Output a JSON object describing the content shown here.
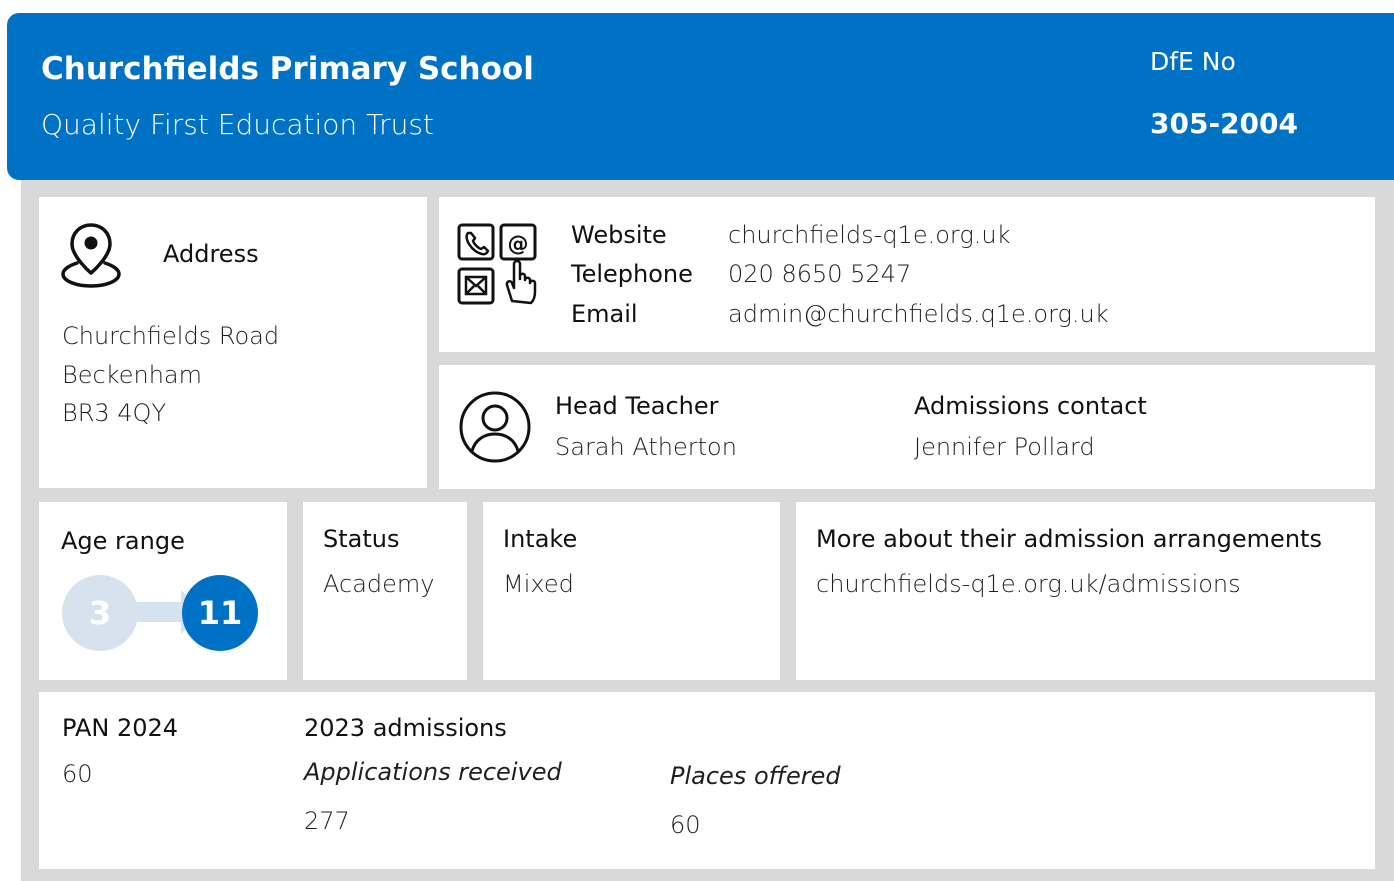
{
  "header": {
    "school_name": "Churchfields Primary School",
    "trust_name": "Quality First Education Trust",
    "dfe_label": "DfE No",
    "dfe_number": "305-2004",
    "color": "#0072c6"
  },
  "address": {
    "label": "Address",
    "lines": [
      "Churchfields Road",
      "Beckenham",
      "BR3 4QY"
    ],
    "icon": "location-pin-icon"
  },
  "contact": {
    "icon": "contact-methods-icon",
    "website_label": "Website",
    "website": "churchfields-q1e.org.uk",
    "telephone_label": "Telephone",
    "telephone": "020 8650 5247",
    "email_label": "Email",
    "email": "admin@churchfields.q1e.org.uk"
  },
  "people": {
    "icon": "person-icon",
    "head_label": "Head Teacher",
    "head_name": "Sarah Atherton",
    "admissions_label": "Admissions contact",
    "admissions_name": "Jennifer Pollard"
  },
  "age_range": {
    "label": "Age range",
    "from": "3",
    "to": "11",
    "from_color": "#d6e3ee",
    "to_color": "#0072c6"
  },
  "status": {
    "label": "Status",
    "value": "Academy"
  },
  "intake": {
    "label": "Intake",
    "value": "Mixed"
  },
  "more": {
    "label": "More about their admission arrangements",
    "link": "churchfields-q1e.org.uk/admissions"
  },
  "pan": {
    "label": "PAN 2024",
    "value": "60"
  },
  "admissions_2023": {
    "label": "2023 admissions",
    "applications_label": "Applications received",
    "applications_value": "277",
    "offered_label": "Places offered",
    "offered_value": "60"
  }
}
